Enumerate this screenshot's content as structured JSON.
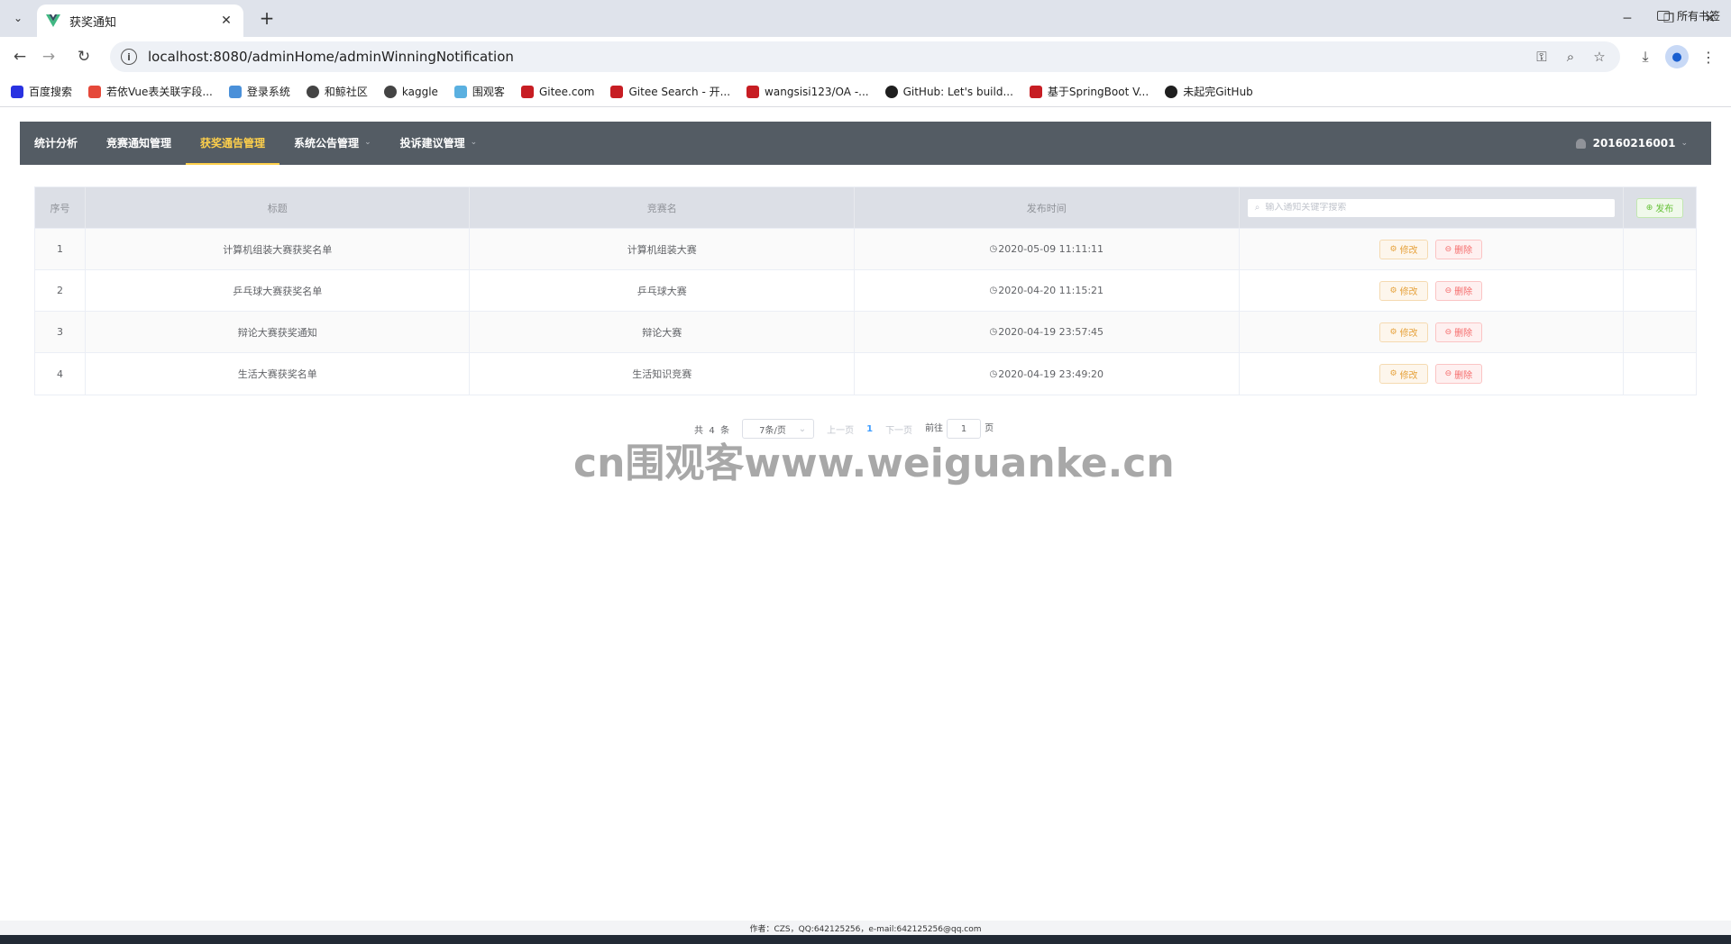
{
  "browser": {
    "tab_title": "获奖通知",
    "url": "localhost:8080/adminHome/adminWinningNotification",
    "bookmarks": [
      {
        "label": "百度搜索",
        "color": "#2932e1",
        "icon": "baidu-icon"
      },
      {
        "label": "若依Vue表关联字段...",
        "color": "#e5483a",
        "icon": "jian-icon"
      },
      {
        "label": "登录系统",
        "color": "#4a90d9",
        "icon": "leaf-icon"
      },
      {
        "label": "和鲸社区",
        "color": "#444444",
        "icon": "globe-icon"
      },
      {
        "label": "kaggle",
        "color": "#444444",
        "icon": "globe-icon"
      },
      {
        "label": "围观客",
        "color": "#5ab0e0",
        "icon": "bars-icon"
      },
      {
        "label": "Gitee.com",
        "color": "#c71d23",
        "icon": "gitee-icon"
      },
      {
        "label": "Gitee Search - 开...",
        "color": "#c71d23",
        "icon": "gitee-icon"
      },
      {
        "label": "wangsisi123/OA -...",
        "color": "#c71d23",
        "icon": "gitee-icon"
      },
      {
        "label": "GitHub: Let's build...",
        "color": "#1f1f1f",
        "icon": "github-icon"
      },
      {
        "label": "基于SpringBoot V...",
        "color": "#c71d23",
        "icon": "gitee-icon"
      },
      {
        "label": "未起完GitHub",
        "color": "#1f1f1f",
        "icon": "github-icon"
      }
    ],
    "all_bookmarks": "所有书签"
  },
  "menu": {
    "items": [
      {
        "label": "统计分析",
        "active": false,
        "dropdown": false
      },
      {
        "label": "竞赛通知管理",
        "active": false,
        "dropdown": false
      },
      {
        "label": "获奖通告管理",
        "active": true,
        "dropdown": false
      },
      {
        "label": "系统公告管理",
        "active": false,
        "dropdown": true
      },
      {
        "label": "投诉建议管理",
        "active": false,
        "dropdown": true
      }
    ],
    "user": "20160216001"
  },
  "table": {
    "headers": {
      "index": "序号",
      "title": "标题",
      "competition": "竞赛名",
      "time": "发布时间"
    },
    "search_placeholder": "输入通知关键字搜索",
    "publish_label": "发布",
    "edit_label": "修改",
    "delete_label": "删除",
    "rows": [
      {
        "index": "1",
        "title": "计算机组装大赛获奖名单",
        "competition": "计算机组装大赛",
        "time": "2020-05-09 11:11:11"
      },
      {
        "index": "2",
        "title": "乒乓球大赛获奖名单",
        "competition": "乒乓球大赛",
        "time": "2020-04-20 11:15:21"
      },
      {
        "index": "3",
        "title": "辩论大赛获奖通知",
        "competition": "辩论大赛",
        "time": "2020-04-19 23:57:45"
      },
      {
        "index": "4",
        "title": "生活大赛获奖名单",
        "competition": "生活知识竞赛",
        "time": "2020-04-19 23:49:20"
      }
    ]
  },
  "pager": {
    "total_prefix": "共",
    "total": "4",
    "total_suffix": "条",
    "page_size": "7条/页",
    "prev": "上一页",
    "current": "1",
    "next": "下一页",
    "goto_prefix": "前往",
    "goto_value": "1",
    "goto_suffix": "页"
  },
  "watermark": "cn围观客www.weiguanke.cn",
  "footer": "作者：CZS，QQ:642125256，e-mail:642125256@qq.com"
}
